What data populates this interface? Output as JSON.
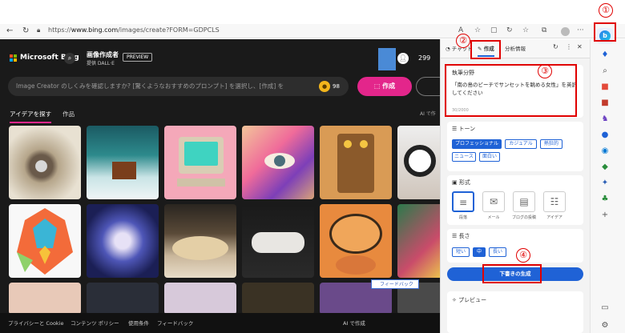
{
  "browser": {
    "url_prefix": "https://",
    "url_host": "www.bing.com",
    "url_path": "/images/create?FORM=GDPCLS"
  },
  "header": {
    "brand": "Microsoft Bing",
    "creator_title": "画像作成者",
    "creator_sub": "提供 DALL·E",
    "preview_badge": "PREVIEW",
    "points": "299"
  },
  "prompt": {
    "placeholder": "Image Creator のしくみを確認しますか? [驚くようなおすすめのプロンプト] を選択し、[作成] を",
    "coin_value": "98",
    "create_label": "作成"
  },
  "tabs": {
    "explore": "アイデアを探す",
    "creations": "作品",
    "ai_label": "AI で作"
  },
  "tiles": [
    "ring-image",
    "cabin-image",
    "computer-image",
    "eye-image",
    "robot-image",
    "panda-image",
    "wolf-image",
    "flower-image",
    "food-image",
    "shoes-image",
    "tiger-image",
    "bird-image",
    "misc-image",
    "chrome-image",
    "lily-image",
    "elephant-image",
    "fish-image",
    "other-image"
  ],
  "footer": {
    "privacy": "プライバシーと Cookie",
    "content_policy": "コンテンツ ポリシー",
    "terms": "使用条件",
    "feedback": "フィードバック",
    "ai_made": "AI で作成",
    "feedback_btn": "フィードバック"
  },
  "panel": {
    "tab_chat": "チャット",
    "tab_compose": "作成",
    "tab_insights": "分析情報",
    "topic_title": "執筆分野",
    "topic_text": "「南の島のビーチでサンセットを眺める女性」を英訳してください",
    "char_count": "30/2000",
    "tone_title": "トーン",
    "tones": [
      "プロフェッショナル",
      "カジュアル",
      "熱狂的",
      "ニュース",
      "面白い"
    ],
    "format_title": "形式",
    "formats": [
      "段落",
      "メール",
      "ブログの投稿",
      "アイデア"
    ],
    "length_title": "長さ",
    "lengths": [
      "短い",
      "中",
      "長い"
    ],
    "generate_label": "下書きの生成",
    "preview_title": "プレビュー"
  },
  "annotations": {
    "n1": "①",
    "n2": "②",
    "n3": "③",
    "n4": "④"
  },
  "colors": {
    "accent_pink": "#e3268b",
    "accent_blue": "#1f62d6",
    "annotation_red": "#e00000"
  }
}
